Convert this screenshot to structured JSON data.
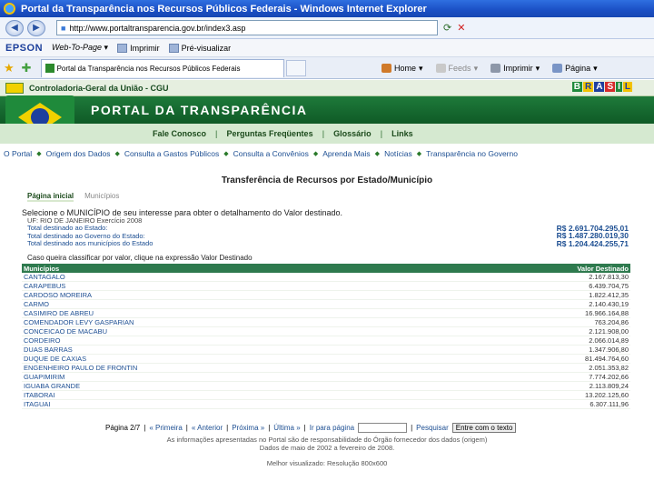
{
  "window": {
    "title": "Portal da Transparência nos Recursos Públicos Federais - Windows Internet Explorer"
  },
  "address": {
    "url": "http://www.portaltransparencia.gov.br/index3.asp"
  },
  "epson_toolbar": {
    "brand": "EPSON",
    "web_to_page": "Web-To-Page ▾",
    "print": "Imprimir",
    "preview": "Pré-visualizar"
  },
  "tab": {
    "label": "Portal da Transparência nos Recursos Públicos Federais"
  },
  "command_bar": {
    "home": "Home",
    "feeds": "Feeds",
    "print": "Imprimir",
    "page": "Página"
  },
  "site": {
    "cgu_name": "Controladoria-Geral da União - CGU",
    "portal_title": "PORTAL DA TRANSPARÊNCIA",
    "brasil_logo": "BRASIL",
    "top_menu": [
      "Fale Conosco",
      "Perguntas Freqüentes",
      "Glossário",
      "Links"
    ],
    "sub_menu": [
      "O Portal",
      "Origem dos Dados",
      "Consulta a Gastos Públicos",
      "Consulta a Convênios",
      "Aprenda Mais",
      "Notícias",
      "Transparência no Governo"
    ]
  },
  "content": {
    "page_title": "Transferência de Recursos por Estado/Município",
    "crumb_active": "Página inicial",
    "crumb_inactive": "Municípios",
    "instruction": "Selecione o MUNICÍPIO de seu interesse para obter o detalhamento do Valor destinado.",
    "uf_line": "UF: RIO DE JANEIRO   Exercício 2008",
    "summary": [
      {
        "label": "Total destinado ao Estado:",
        "value": "R$ 2.691.704.295,01"
      },
      {
        "label": "Total destinado ao Governo do Estado:",
        "value": "R$ 1.487.280.019,30"
      },
      {
        "label": "Total destinado aos municípios do Estado",
        "value": "R$ 1.204.424.255,71"
      }
    ],
    "sort_note": "Caso queira classificar por valor, clique na expressão Valor Destinado",
    "table": {
      "col_municipio": "Municípios",
      "col_valor": "Valor Destinado",
      "rows": [
        {
          "name": "CANTAGALO",
          "value": "2.167.813,30"
        },
        {
          "name": "CARAPEBUS",
          "value": "6.439.704,75"
        },
        {
          "name": "CARDOSO MOREIRA",
          "value": "1.822.412,35"
        },
        {
          "name": "CARMO",
          "value": "2.140.430,19"
        },
        {
          "name": "CASIMIRO DE ABREU",
          "value": "16.966.164,88"
        },
        {
          "name": "COMENDADOR LEVY GASPARIAN",
          "value": "763.204,86"
        },
        {
          "name": "CONCEICAO DE MACABU",
          "value": "2.121.908,00"
        },
        {
          "name": "CORDEIRO",
          "value": "2.066.014,89"
        },
        {
          "name": "DUAS BARRAS",
          "value": "1.347.906,80"
        },
        {
          "name": "DUQUE DE CAXIAS",
          "value": "81.494.764,60"
        },
        {
          "name": "ENGENHEIRO PAULO DE FRONTIN",
          "value": "2.051.353,82"
        },
        {
          "name": "GUAPIMIRIM",
          "value": "7.774.202,66"
        },
        {
          "name": "IGUABA GRANDE",
          "value": "2.113.809,24"
        },
        {
          "name": "ITABORAI",
          "value": "13.202.125,60"
        },
        {
          "name": "ITAGUAI",
          "value": "6.307.111,96"
        }
      ]
    },
    "pager": {
      "page": "Página 2/7",
      "first": "« Primeira",
      "prev": "« Anterior",
      "next": "Próxima »",
      "last": "Última »",
      "goto": "Ir para página",
      "search": "Pesquisar",
      "search_btn": "Entre com o texto"
    },
    "footer_note": "As informações apresentadas no Portal são de responsabilidade do Órgão fornecedor dos dados (origem)",
    "footer_dates": "Dados de maio de 2002 a fevereiro de 2008.",
    "footer_resolution": "Melhor visualizado: Resolução 800x600"
  }
}
